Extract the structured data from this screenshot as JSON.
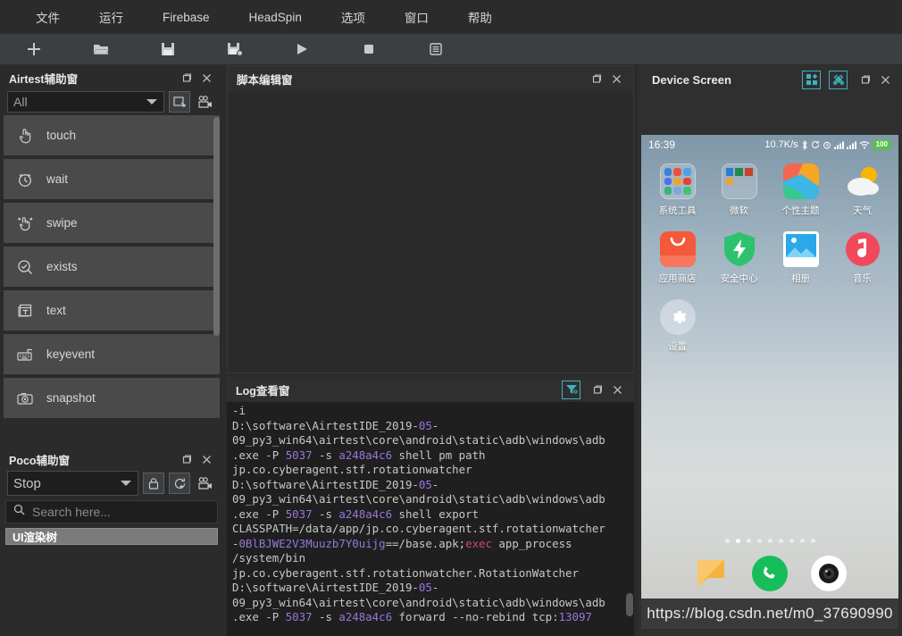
{
  "menubar": {
    "items": [
      {
        "label": "文件",
        "name": "menu-file"
      },
      {
        "label": "运行",
        "name": "menu-run"
      },
      {
        "label": "Firebase",
        "name": "menu-firebase"
      },
      {
        "label": "HeadSpin",
        "name": "menu-headspin"
      },
      {
        "label": "选项",
        "name": "menu-options"
      },
      {
        "label": "窗口",
        "name": "menu-window"
      },
      {
        "label": "帮助",
        "name": "menu-help"
      }
    ]
  },
  "toolbar": {
    "items": [
      {
        "icon": "plus-icon",
        "title": "新建"
      },
      {
        "icon": "folder-open-icon",
        "title": "打开"
      },
      {
        "icon": "save-icon",
        "title": "保存"
      },
      {
        "icon": "save-as-icon",
        "title": "另存为"
      },
      {
        "icon": "run-icon",
        "title": "运行"
      },
      {
        "icon": "stop-icon",
        "title": "停止"
      },
      {
        "icon": "report-icon",
        "title": "报告"
      }
    ]
  },
  "airtest_panel": {
    "title": "Airtest辅助窗",
    "filter_value": "All",
    "filter_options": [
      "All"
    ],
    "buttons": [
      {
        "icon": "screenshot-region-icon",
        "name": "airtest-screen-capture-button"
      },
      {
        "icon": "camera-record-icon",
        "name": "airtest-record-button"
      }
    ],
    "commands": [
      {
        "label": "touch",
        "icon": "touch-hand-icon"
      },
      {
        "label": "wait",
        "icon": "clock-icon"
      },
      {
        "label": "swipe",
        "icon": "swipe-hand-icon"
      },
      {
        "label": "exists",
        "icon": "magnifier-check-icon"
      },
      {
        "label": "text",
        "icon": "text-window-icon"
      },
      {
        "label": "keyevent",
        "icon": "keyboard-icon"
      },
      {
        "label": "snapshot",
        "icon": "camera-icon"
      }
    ],
    "window_buttons": [
      {
        "icon": "restore-icon",
        "name": "airtest-restore-button"
      },
      {
        "icon": "close-icon",
        "name": "airtest-close-button"
      }
    ]
  },
  "poco_panel": {
    "title": "Poco辅助窗",
    "mode_value": "Stop",
    "mode_options": [
      "Stop"
    ],
    "buttons": [
      {
        "icon": "lock-icon",
        "name": "poco-lock-button"
      },
      {
        "icon": "refresh-icon",
        "name": "poco-refresh-button"
      },
      {
        "icon": "camera-record-icon",
        "name": "poco-record-button"
      }
    ],
    "search_placeholder": "Search here...",
    "search_value": "",
    "tree_root_label": "UI渲染树",
    "window_buttons": [
      {
        "icon": "restore-icon",
        "name": "poco-restore-button"
      },
      {
        "icon": "close-icon",
        "name": "poco-close-button"
      }
    ]
  },
  "editor_panel": {
    "title": "脚本编辑窗",
    "content": "",
    "window_buttons": [
      {
        "icon": "restore-icon",
        "name": "editor-restore-button"
      },
      {
        "icon": "close-icon",
        "name": "editor-close-button"
      }
    ]
  },
  "log_panel": {
    "title": "Log查看窗",
    "filter_button": "filter-funnel-icon",
    "window_buttons": [
      {
        "icon": "restore-icon",
        "name": "log-restore-button"
      },
      {
        "icon": "close-icon",
        "name": "log-close-button"
      }
    ],
    "lines": [
      "-i",
      "D:\\software\\AirtestIDE_2019-05-",
      "09_py3_win64\\airtest\\core\\android\\static\\adb\\windows\\adb",
      ".exe -P 5037 -s a248a4c6 shell pm path",
      "jp.co.cyberagent.stf.rotationwatcher",
      "D:\\software\\AirtestIDE_2019-05-",
      "09_py3_win64\\airtest\\core\\android\\static\\adb\\windows\\adb",
      ".exe -P 5037 -s a248a4c6 shell export",
      "CLASSPATH=/data/app/jp.co.cyberagent.stf.rotationwatcher",
      "-0BlBJWE2V3Muuzb7Y0uijg==/base.apk;exec app_process",
      "/system/bin",
      "jp.co.cyberagent.stf.rotationwatcher.RotationWatcher",
      "D:\\software\\AirtestIDE_2019-05-",
      "09_py3_win64\\airtest\\core\\android\\static\\adb\\windows\\adb",
      ".exe -P 5037 -s a248a4c6 forward --no-rebind tcp:13097"
    ]
  },
  "device_panel": {
    "title": "Device Screen",
    "buttons": [
      {
        "icon": "apps-grid-icon",
        "name": "device-apps-button"
      },
      {
        "icon": "tools-icon",
        "name": "device-tools-button"
      }
    ],
    "window_buttons": [
      {
        "icon": "restore-icon",
        "name": "device-restore-button"
      },
      {
        "icon": "close-icon",
        "name": "device-close-button"
      }
    ],
    "status_bar": {
      "clock": "16:39",
      "net_speed": "10.7K/s",
      "icons": [
        "bluetooth-icon",
        "sync-icon",
        "alarm-icon",
        "signal-icon",
        "signal2-icon",
        "wifi-icon"
      ],
      "battery": "100"
    },
    "apps_row1": [
      {
        "label": "系统工具",
        "icon": "system-tools-folder-icon"
      },
      {
        "label": "微软",
        "icon": "microsoft-folder-icon"
      },
      {
        "label": "个性主题",
        "icon": "themes-icon"
      },
      {
        "label": "天气",
        "icon": "weather-icon"
      }
    ],
    "apps_row2": [
      {
        "label": "应用商店",
        "icon": "app-store-icon"
      },
      {
        "label": "安全中心",
        "icon": "security-center-icon"
      },
      {
        "label": "相册",
        "icon": "gallery-icon"
      },
      {
        "label": "音乐",
        "icon": "music-icon"
      }
    ],
    "apps_row3": [
      {
        "label": "设置",
        "icon": "settings-icon"
      }
    ],
    "page_dots": {
      "count": 9,
      "active_index": 1
    },
    "dock": [
      {
        "icon": "messages-icon",
        "name": "dock-messages"
      },
      {
        "icon": "phone-icon",
        "name": "dock-phone"
      },
      {
        "icon": "camera-dock-icon",
        "name": "dock-camera"
      }
    ],
    "watermark": "https://blog.csdn.net/m0_37690990"
  },
  "colors": {
    "window_bg": "#2b2b2b",
    "panel_bg": "#2f2f2f",
    "toolbar_bg": "#3c3f41",
    "item_bg": "#4a4a4a",
    "accent_teal": "#3fb0bf",
    "log_bg": "#1f1f1f",
    "log_number": "#9876dd",
    "log_keyword": "#cc4b6e",
    "selection": "#7a7a7a"
  }
}
